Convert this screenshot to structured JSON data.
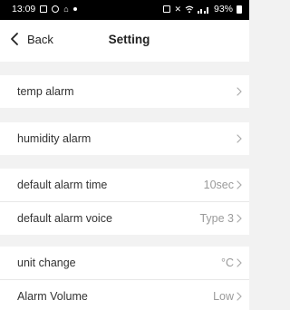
{
  "status_bar": {
    "time": "13:09",
    "battery": "93%",
    "icons": [
      "image-icon",
      "camera-icon",
      "home-icon",
      "dot-icon",
      "alarm-icon",
      "mute-icon",
      "wifi-icon",
      "signal-icon",
      "battery-icon"
    ]
  },
  "nav": {
    "back_label": "Back",
    "title": "Setting"
  },
  "settings": {
    "temp_alarm": {
      "label": "temp alarm",
      "value": ""
    },
    "humidity_alarm": {
      "label": "humidity alarm",
      "value": ""
    },
    "default_alarm_time": {
      "label": "default alarm time",
      "value": "10sec"
    },
    "default_alarm_voice": {
      "label": "default alarm voice",
      "value": "Type 3"
    },
    "unit_change": {
      "label": "unit change",
      "value": "°C"
    },
    "alarm_volume": {
      "label": "Alarm Volume",
      "value": "Low"
    }
  },
  "colors": {
    "background": "#f2f2f2",
    "row_background": "#ffffff",
    "value_text": "#9a9a9a",
    "status_bar": "#000000"
  }
}
